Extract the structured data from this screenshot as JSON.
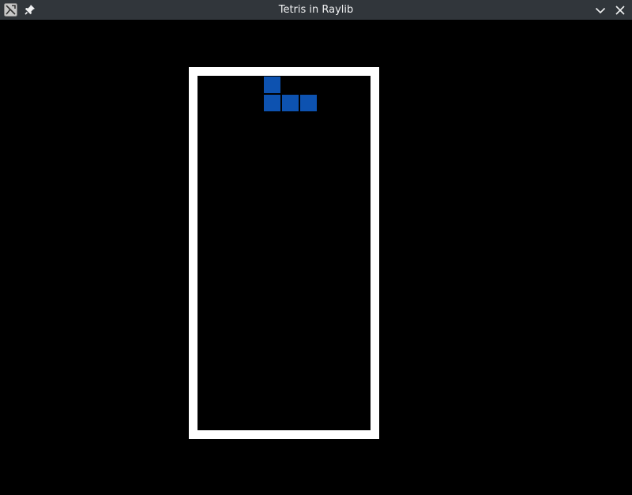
{
  "window": {
    "title": "Tetris in Raylib",
    "titlebar_color": "#31363b",
    "title_color": "#eff0f1",
    "icons": {
      "app": "raylib-app-icon",
      "pin": "pin-icon",
      "minimize": "chevron-down-icon",
      "close": "close-icon"
    }
  },
  "game": {
    "background": "#000000",
    "board_border_color": "#ffffff",
    "board_background": "#000000",
    "board_columns": 10,
    "board_rows": 20,
    "active_piece": {
      "shape": "J",
      "color": "#0d52b0",
      "cells": [
        {
          "col": 4,
          "row": 0
        },
        {
          "col": 4,
          "row": 1
        },
        {
          "col": 5,
          "row": 1
        },
        {
          "col": 6,
          "row": 1
        }
      ]
    }
  }
}
